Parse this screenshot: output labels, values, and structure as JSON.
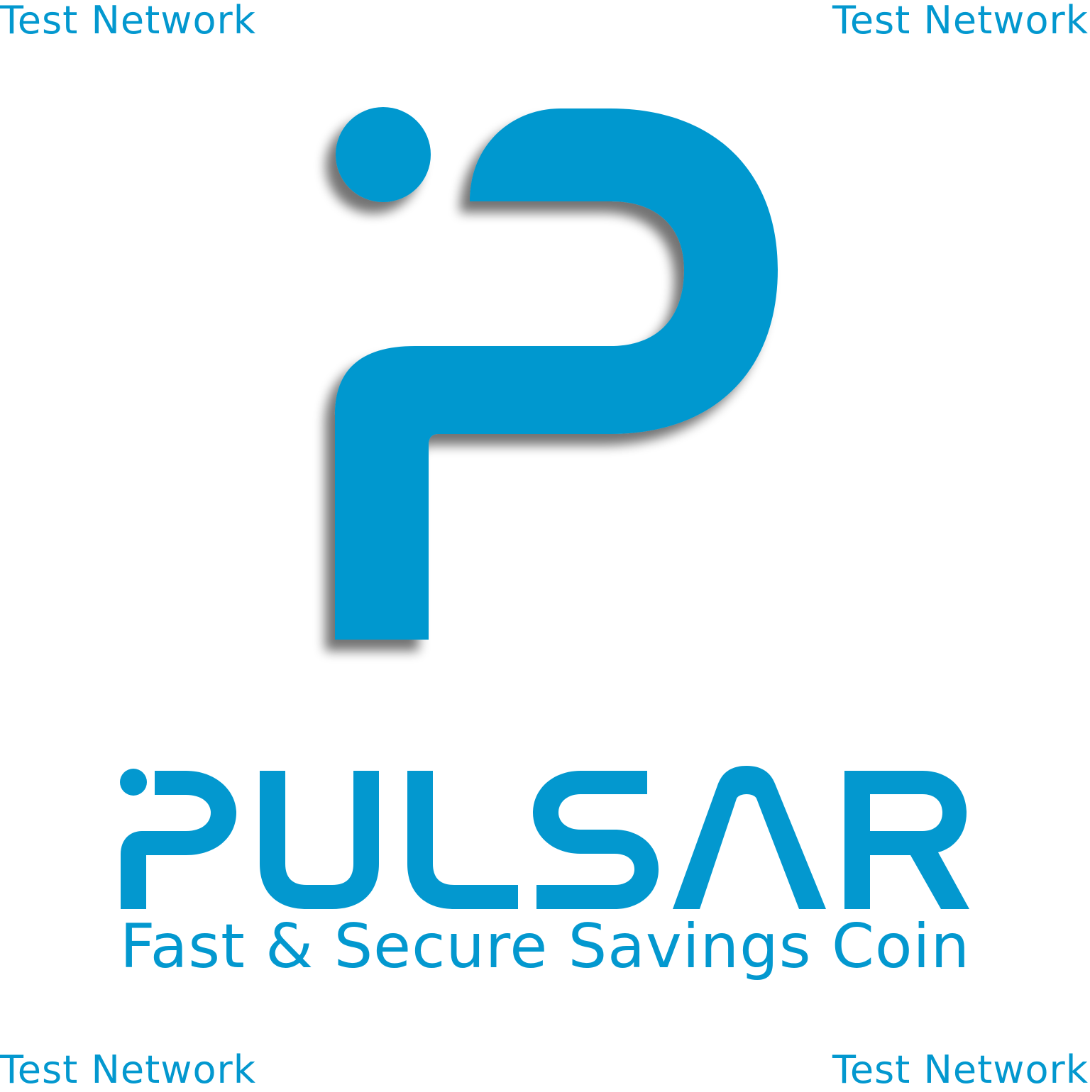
{
  "watermark": {
    "top_left": "Test Network",
    "top_right": "Test Network",
    "bottom_left": "Test Network",
    "bottom_right": "Test Network"
  },
  "brand": {
    "name": "PULSAR",
    "tagline": "Fast & Secure Savings Coin",
    "color": "#0398CF",
    "logo_icon": "pulsar-p-icon"
  }
}
